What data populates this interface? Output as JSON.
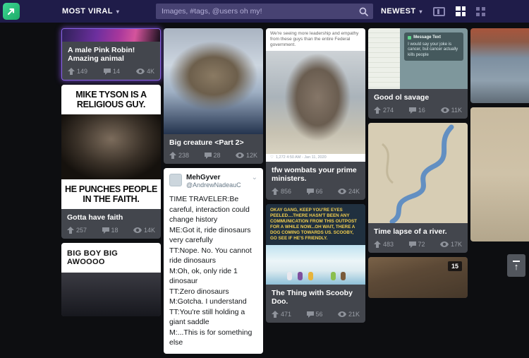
{
  "icons": {
    "caret_down": "▾",
    "chevron_down": "⌄",
    "heart": "♡",
    "up_arrow": "↑"
  },
  "nav": {
    "section_label": "MOST VIRAL",
    "search_placeholder": "Images, #tags, @users oh my!",
    "sort_label": "NEWEST"
  },
  "colors": {
    "nav_bg": "#1f1c49",
    "logo_green": "#1cab67",
    "card_bg": "#43464d",
    "page_bg": "#0d0e11"
  },
  "cards": {
    "robin": {
      "title": "A male Pink Robin! Amazing animal",
      "ups": "149",
      "comments": "14",
      "views": "4K"
    },
    "tyson": {
      "meme_top": "MIKE TYSON IS A RELIGIOUS GUY.",
      "meme_bottom": "HE PUNCHES PEOPLE IN THE FAITH.",
      "title": "Gotta have faith",
      "ups": "257",
      "comments": "18",
      "views": "14K"
    },
    "bigboy": {
      "meme_top": "BIG BOY BIG AWOOOO"
    },
    "sparrow": {
      "title": "Big creature <Part 2>",
      "ups": "238",
      "comments": "28",
      "views": "12K"
    },
    "tweet": {
      "name": "MehGyver",
      "handle": "@AndrewNadeauC",
      "lines": [
        "TIME TRAVELER:Be careful, interaction could change history",
        "ME:Got it, ride dinosaurs very carefully",
        "TT:Nope. No. You cannot ride dinosaurs",
        "M:Oh, ok, only ride 1 dinosaur",
        "TT:Zero dinosaurs",
        "M:Gotcha. I understand",
        "TT:You're still holding a giant saddle",
        "M:...This is for something else"
      ]
    },
    "wombat": {
      "caption": "We're seeing more leadership and empathy from these guys than the entire Federal government.",
      "meta": "1,272   4:50 AM - Jan 11, 2020",
      "title": "tfw wombats your prime ministers.",
      "ups": "856",
      "comments": "66",
      "views": "24K"
    },
    "scooby": {
      "caption": "OKAY GANG, KEEP YOU'RE EYES PEELED....THERE HASN'T BEEN ANY COMMUNICATION FROM THIS OUTPOST FOR A WHILE NOW...OH WAIT, THERE A DOG COMING TOWARDS US. SCOOBY, GO SEE IF HE'S FRIENDLY.",
      "title": "The Thing with Scooby Doo.",
      "ups": "471",
      "comments": "56",
      "views": "21K"
    },
    "savage": {
      "overlay_title": "Message Text",
      "overlay_body": "I would say your joke is cancer, but cancer actually kills people",
      "title": "Good ol savage",
      "ups": "274",
      "comments": "16",
      "views": "11K"
    },
    "river": {
      "title": "Time lapse of a river.",
      "ups": "483",
      "comments": "72",
      "views": "17K"
    },
    "wood": {
      "badge": "15"
    }
  }
}
